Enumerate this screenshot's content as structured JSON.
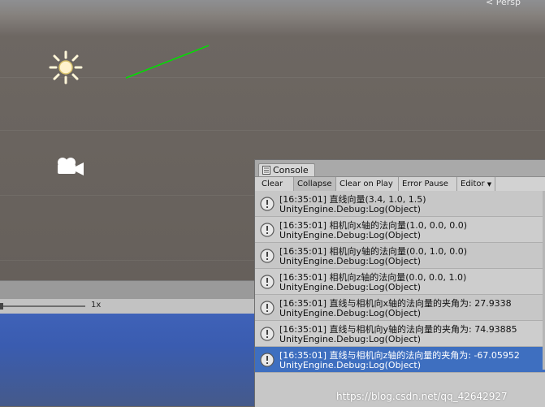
{
  "scene": {
    "perspective_label": "< Persp",
    "timescale_label": "1x",
    "icons": {
      "light": "sun-icon",
      "camera": "camera-icon"
    },
    "colors": {
      "gizmo_line": "#00e000",
      "selected_row": "#3e6fc0",
      "scene_bottom_blue": "#3f62b8"
    }
  },
  "console": {
    "tab_label": "Console",
    "tab_icon": "console-icon",
    "toolbar": {
      "clear": "Clear",
      "collapse": "Collapse",
      "clear_on_play": "Clear on Play",
      "error_pause": "Error Pause",
      "editor": "Editor"
    },
    "entries": [
      {
        "line1": "[16:35:01] 直线向量(3.4, 1.0, 1.5)",
        "line2": "UnityEngine.Debug:Log(Object)"
      },
      {
        "line1": "[16:35:01] 相机向x轴的法向量(1.0, 0.0, 0.0)",
        "line2": "UnityEngine.Debug:Log(Object)"
      },
      {
        "line1": "[16:35:01] 相机向y轴的法向量(0.0, 1.0, 0.0)",
        "line2": "UnityEngine.Debug:Log(Object)"
      },
      {
        "line1": "[16:35:01] 相机向z轴的法向量(0.0, 0.0, 1.0)",
        "line2": "UnityEngine.Debug:Log(Object)"
      },
      {
        "line1": "[16:35:01] 直线与相机向x轴的法向量的夹角为:  27.9338",
        "line2": "UnityEngine.Debug:Log(Object)"
      },
      {
        "line1": "[16:35:01] 直线与相机向y轴的法向量的夹角为:  74.93885",
        "line2": "UnityEngine.Debug:Log(Object)"
      },
      {
        "line1": "[16:35:01] 直线与相机向z轴的法向量的夹角为:  -67.05952",
        "line2": "UnityEngine.Debug:Log(Object)"
      }
    ],
    "selected_index": 6,
    "watermark": "https://blog.csdn.net/qq_42642927"
  }
}
